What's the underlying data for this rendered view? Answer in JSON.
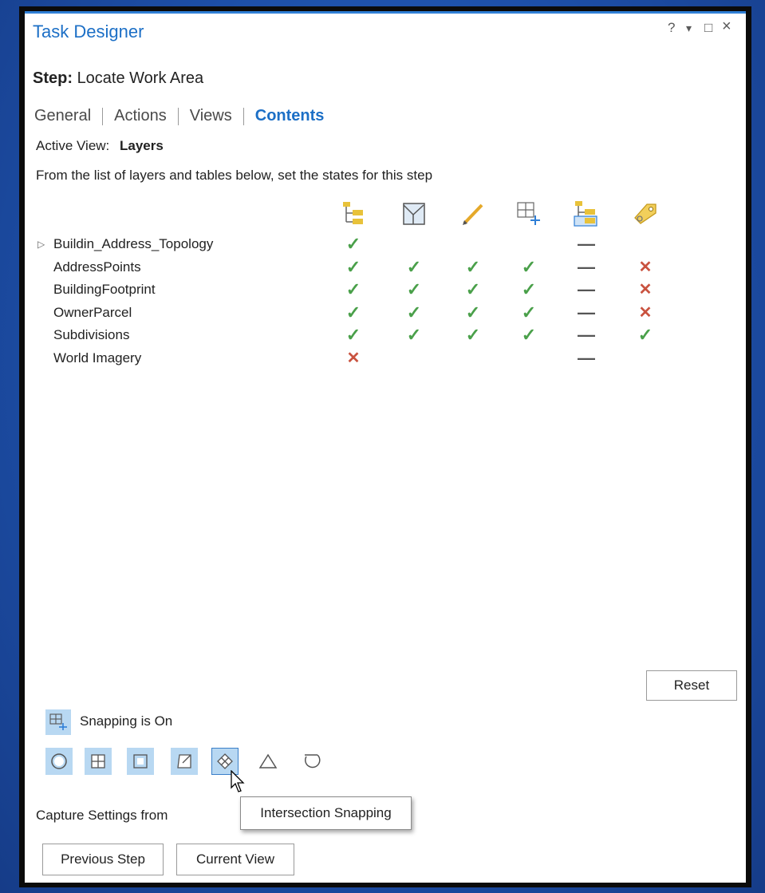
{
  "window": {
    "title": "Task Designer",
    "controls": [
      "?",
      "▾",
      "□",
      "×"
    ]
  },
  "step": {
    "label": "Step:",
    "name": "Locate Work Area"
  },
  "tabs": [
    {
      "label": "General",
      "active": false
    },
    {
      "label": "Actions",
      "active": false
    },
    {
      "label": "Views",
      "active": false
    },
    {
      "label": "Contents",
      "active": true
    }
  ],
  "active_view": {
    "label": "Active View:",
    "value": "Layers"
  },
  "instruction": "From the list of layers and tables below, set the states for this step",
  "columns": [
    {
      "icon": "visible-layer-icon"
    },
    {
      "icon": "selectable-layer-icon"
    },
    {
      "icon": "editable-pencil-icon"
    },
    {
      "icon": "snappable-grid-icon"
    },
    {
      "icon": "expanded-layer-icon"
    },
    {
      "icon": "label-tag-icon"
    }
  ],
  "layers": [
    {
      "name": "Buildin_Address_Topology",
      "expandable": true,
      "states": [
        "check",
        "",
        "",
        "",
        "dash",
        ""
      ]
    },
    {
      "name": "AddressPoints",
      "expandable": false,
      "states": [
        "check",
        "check",
        "check",
        "check",
        "dash",
        "x"
      ]
    },
    {
      "name": "BuildingFootprint",
      "expandable": false,
      "states": [
        "check",
        "check",
        "check",
        "check",
        "dash",
        "x"
      ]
    },
    {
      "name": "OwnerParcel",
      "expandable": false,
      "states": [
        "check",
        "check",
        "check",
        "check",
        "dash",
        "x"
      ]
    },
    {
      "name": "Subdivisions",
      "expandable": false,
      "states": [
        "check",
        "check",
        "check",
        "check",
        "dash",
        "check"
      ]
    },
    {
      "name": "World Imagery",
      "expandable": false,
      "states": [
        "x",
        "",
        "",
        "",
        "dash",
        ""
      ]
    }
  ],
  "reset_label": "Reset",
  "snapping": {
    "status": "Snapping is On",
    "modes": [
      {
        "icon": "point-snap-icon",
        "on": true
      },
      {
        "icon": "grid-snap-icon",
        "on": true
      },
      {
        "icon": "edge-snap-icon",
        "on": true
      },
      {
        "icon": "vertex-snap-icon",
        "on": true
      },
      {
        "icon": "intersection-snap-icon",
        "on": true,
        "selected": true
      },
      {
        "icon": "midpoint-snap-icon",
        "on": false
      },
      {
        "icon": "tangent-snap-icon",
        "on": false
      }
    ]
  },
  "tooltip": "Intersection Snapping",
  "capture": {
    "label": "Capture Settings from",
    "previous_step": "Previous Step",
    "current_view": "Current View"
  },
  "colors": {
    "accent": "#1c6fc6",
    "check": "#4aa04a",
    "x": "#c9523f",
    "snap_bg": "#b8d8f2"
  }
}
